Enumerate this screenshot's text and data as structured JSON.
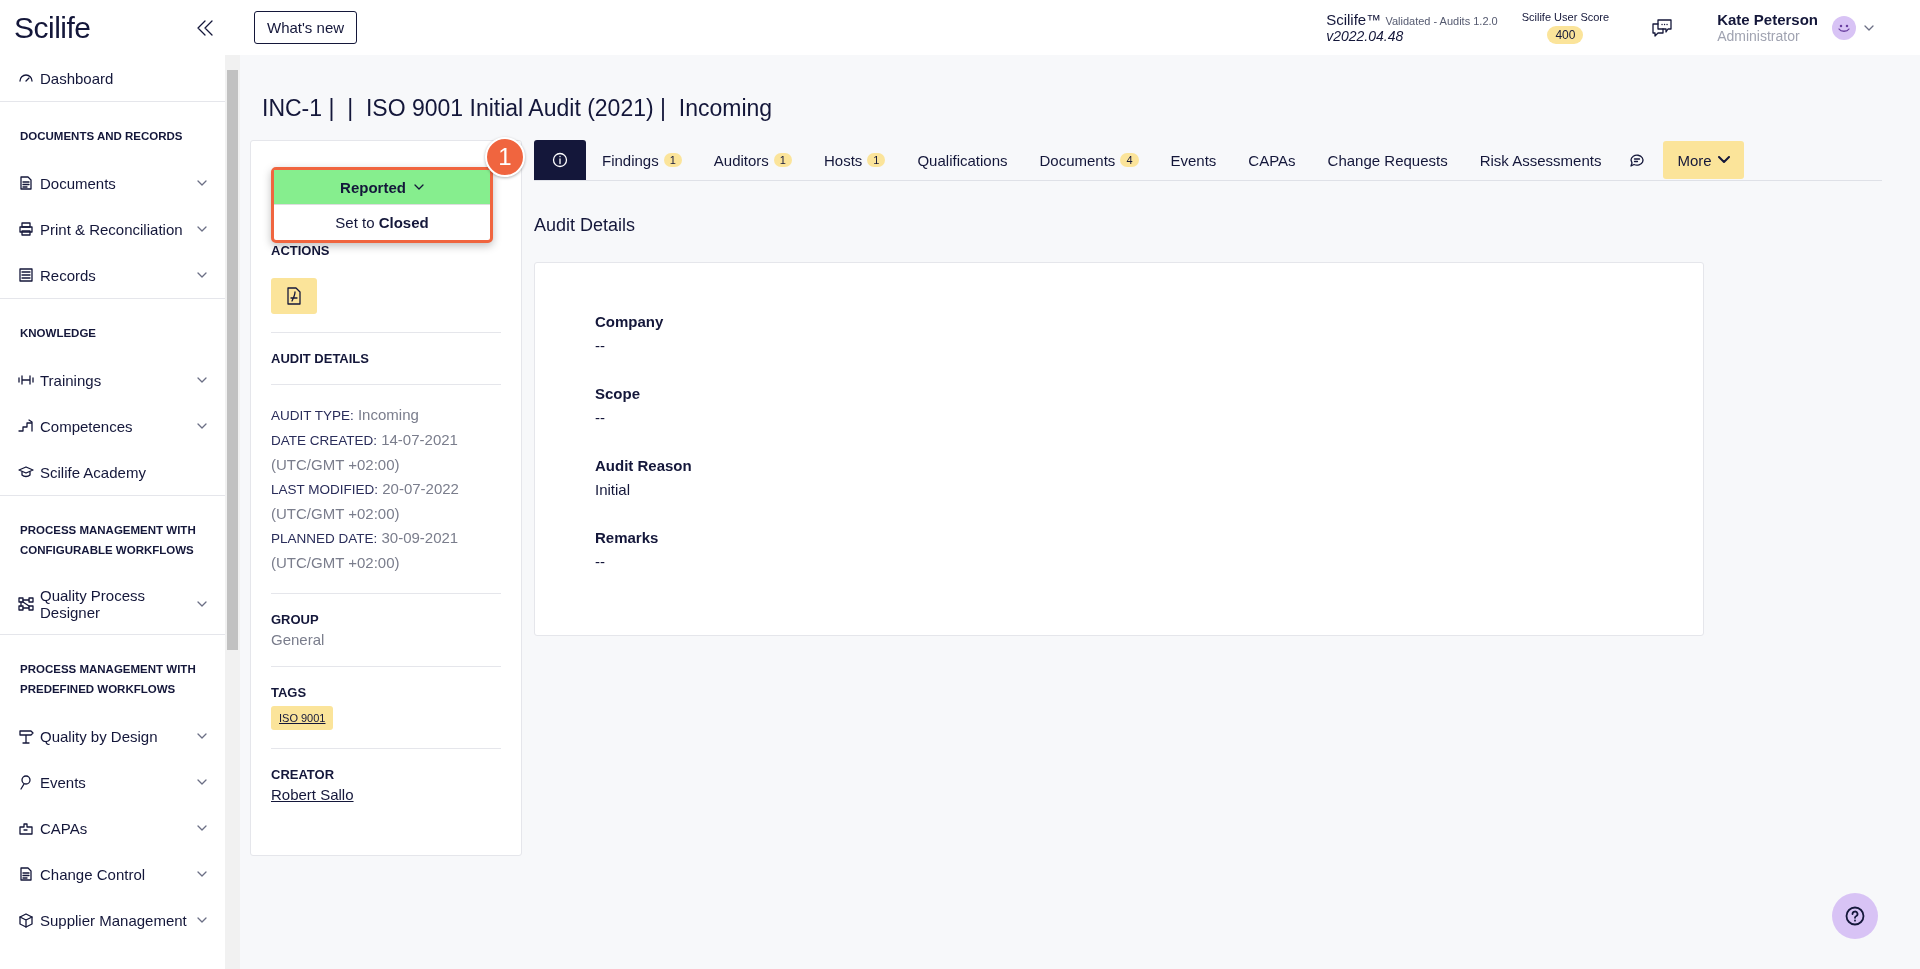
{
  "sidebar": {
    "logo": "Scilife",
    "items": [
      {
        "kind": "link",
        "label": "Dashboard",
        "expandable": false
      },
      {
        "kind": "heading",
        "label": "DOCUMENTS AND RECORDS"
      },
      {
        "kind": "link",
        "label": "Documents",
        "expandable": true
      },
      {
        "kind": "link",
        "label": "Print & Reconciliation",
        "expandable": true
      },
      {
        "kind": "link",
        "label": "Records",
        "expandable": true
      },
      {
        "kind": "heading",
        "label": "KNOWLEDGE"
      },
      {
        "kind": "link",
        "label": "Trainings",
        "expandable": true
      },
      {
        "kind": "link",
        "label": "Competences",
        "expandable": true
      },
      {
        "kind": "link",
        "label": "Scilife Academy",
        "expandable": false
      },
      {
        "kind": "heading",
        "label": "PROCESS MANAGEMENT WITH CONFIGURABLE WORKFLOWS"
      },
      {
        "kind": "link",
        "label": "Quality Process Designer",
        "expandable": true
      },
      {
        "kind": "heading",
        "label": "PROCESS MANAGEMENT WITH PREDEFINED WORKFLOWS"
      },
      {
        "kind": "link",
        "label": "Quality by Design",
        "expandable": true
      },
      {
        "kind": "link",
        "label": "Events",
        "expandable": true
      },
      {
        "kind": "link",
        "label": "CAPAs",
        "expandable": true
      },
      {
        "kind": "link",
        "label": "Change Control",
        "expandable": true
      },
      {
        "kind": "link",
        "label": "Supplier Management",
        "expandable": true
      }
    ]
  },
  "topbar": {
    "whats_new": "What's new",
    "app": {
      "name": "Scilife™",
      "edition": "Validated - Audits 1.2.0",
      "version": "v2022.04.48"
    },
    "score": {
      "label": "Scilife User Score",
      "value": "400"
    },
    "user": {
      "name": "Kate Peterson",
      "role": "Administrator"
    }
  },
  "title": "INC-1 |  |  ISO 9001 Initial Audit (2021) |  Incoming",
  "panel": {
    "status": {
      "label": "Reported",
      "option": "Set to **Closed**"
    },
    "callout": "1",
    "actions_heading": "ACTIONS",
    "audit_details_heading": "AUDIT DETAILS",
    "details": [
      {
        "key": "AUDIT TYPE:",
        "value": "Incoming"
      },
      {
        "key": "DATE CREATED:",
        "value": "14-07-2021 (UTC/GMT +02:00)"
      },
      {
        "key": "LAST MODIFIED:",
        "value": "20-07-2022 (UTC/GMT +02:00)"
      },
      {
        "key": "PLANNED DATE:",
        "value": "30-09-2021 (UTC/GMT +02:00)"
      }
    ],
    "group_heading": "GROUP",
    "group": "General",
    "tags_heading": "TAGS",
    "tags": [
      "ISO 9001"
    ],
    "creator_heading": "CREATOR",
    "creator": "Robert Sallo"
  },
  "tabs": [
    {
      "kind": "info",
      "selected": true
    },
    {
      "kind": "text",
      "label": "Findings",
      "count": "1",
      "selected": false
    },
    {
      "kind": "text",
      "label": "Auditors",
      "count": "1",
      "selected": false
    },
    {
      "kind": "text",
      "label": "Hosts",
      "count": "1",
      "selected": false
    },
    {
      "kind": "text",
      "label": "Qualifications",
      "selected": false
    },
    {
      "kind": "text",
      "label": "Documents",
      "count": "4",
      "selected": false
    },
    {
      "kind": "text",
      "label": "Events",
      "selected": false
    },
    {
      "kind": "text",
      "label": "CAPAs",
      "selected": false
    },
    {
      "kind": "text",
      "label": "Change Requests",
      "selected": false
    },
    {
      "kind": "text",
      "label": "Risk Assessments",
      "selected": false
    },
    {
      "kind": "comments",
      "selected": false
    }
  ],
  "more": "More",
  "details_heading": "Audit Details",
  "fields": [
    {
      "label": "Company",
      "value": "--"
    },
    {
      "label": "Scope",
      "value": "--"
    },
    {
      "label": "Audit Reason",
      "value": "Initial"
    },
    {
      "label": "Remarks",
      "value": "--"
    }
  ]
}
